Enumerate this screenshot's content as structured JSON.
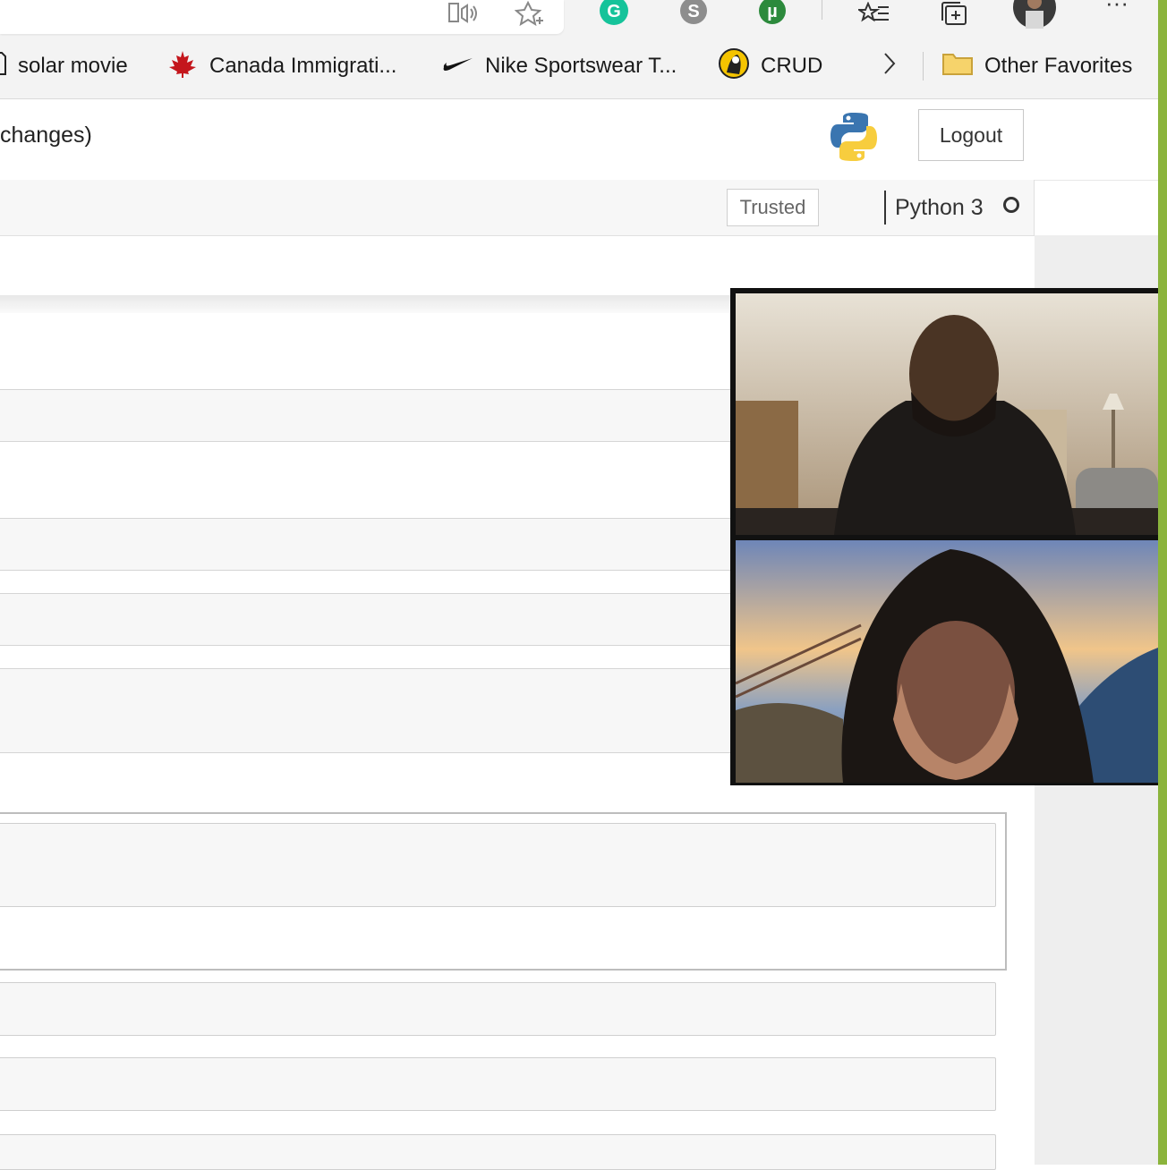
{
  "browser": {
    "toolbar_icons": [
      "read-aloud-icon",
      "add-favorite-icon",
      "grammarly-icon",
      "skype-icon",
      "utorrent-icon",
      "favorites-list-icon",
      "collections-icon",
      "profile-avatar",
      "more-icon"
    ],
    "more_label": "···"
  },
  "bookmarks": {
    "items": [
      {
        "label": "solar movie",
        "icon": "page-icon"
      },
      {
        "label": "Canada Immigrati...",
        "icon": "maple-leaf-icon"
      },
      {
        "label": "Nike Sportswear T...",
        "icon": "nike-swoosh-icon"
      },
      {
        "label": "CRUD",
        "icon": "crud-icon"
      }
    ],
    "overflow_icon": "chevron-right-icon",
    "other_favorites": "Other Favorites"
  },
  "notebook": {
    "title_fragment": "changes)",
    "logout_label": "Logout",
    "trusted_label": "Trusted",
    "kernel_name": "Python 3"
  },
  "colors": {
    "accent_green": "#8bb43c",
    "python_blue": "#3a75b0",
    "python_yellow": "#f7cd3e"
  },
  "video_call": {
    "participants": [
      "participant-1",
      "participant-2"
    ]
  }
}
